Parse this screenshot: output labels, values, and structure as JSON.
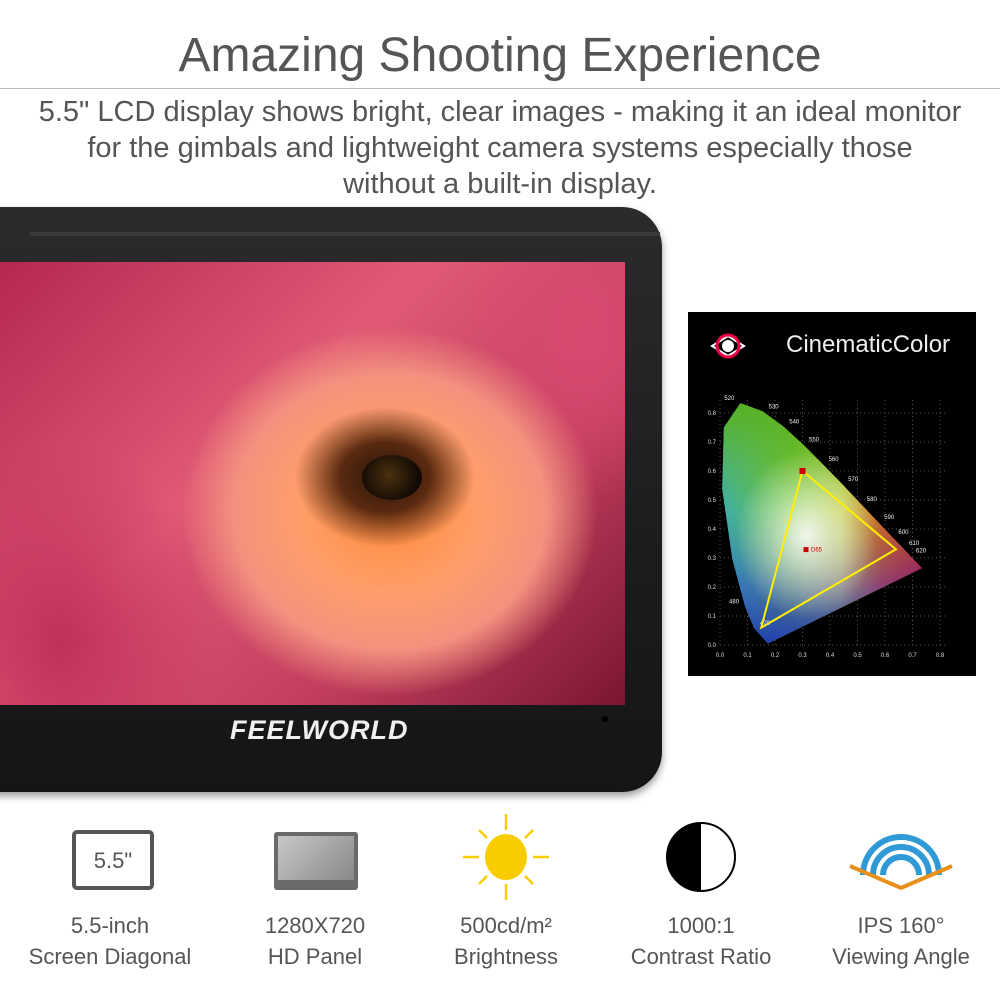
{
  "header": {
    "title": "Amazing Shooting Experience",
    "subtitle_lines": [
      "5.5\" LCD display shows bright, clear images - making it an ideal monitor",
      "for the gimbals and lightweight camera systems especially those",
      "without a built-in display."
    ]
  },
  "monitor": {
    "brand_logo": "FEELWORLD"
  },
  "cinematic_color": {
    "brand": "CinematicColor",
    "white_point_label": "D65",
    "x_ticks": [
      "0.0",
      "0.1",
      "0.2",
      "0.3",
      "0.4",
      "0.5",
      "0.6",
      "0.7",
      "0.8"
    ],
    "y_ticks": [
      "0.0",
      "0.1",
      "0.2",
      "0.3",
      "0.4",
      "0.5",
      "0.6",
      "0.7",
      "0.8"
    ],
    "wavelength_labels": [
      {
        "nm": "470",
        "x": 0.124,
        "y": 0.058
      },
      {
        "nm": "480",
        "x": 0.091,
        "y": 0.133
      },
      {
        "nm": "520",
        "x": 0.074,
        "y": 0.834
      },
      {
        "nm": "530",
        "x": 0.155,
        "y": 0.806
      },
      {
        "nm": "540",
        "x": 0.23,
        "y": 0.754
      },
      {
        "nm": "550",
        "x": 0.302,
        "y": 0.692
      },
      {
        "nm": "560",
        "x": 0.373,
        "y": 0.624
      },
      {
        "nm": "570",
        "x": 0.444,
        "y": 0.555
      },
      {
        "nm": "580",
        "x": 0.512,
        "y": 0.487
      },
      {
        "nm": "590",
        "x": 0.575,
        "y": 0.424
      },
      {
        "nm": "600",
        "x": 0.627,
        "y": 0.372
      },
      {
        "nm": "610",
        "x": 0.666,
        "y": 0.334
      },
      {
        "nm": "620",
        "x": 0.691,
        "y": 0.308
      }
    ],
    "gamut_triangle": [
      [
        0.3,
        0.6
      ],
      [
        0.64,
        0.33
      ],
      [
        0.15,
        0.06
      ]
    ],
    "white_point": [
      0.3127,
      0.329
    ]
  },
  "features": [
    {
      "icon": "screen-diagonal-icon",
      "icon_text": "5.5\"",
      "line1": "5.5-inch",
      "line2": "Screen Diagonal"
    },
    {
      "icon": "hd-panel-icon",
      "line1": "1280X720",
      "line2": "HD Panel"
    },
    {
      "icon": "sun-icon",
      "line1": "500cd/m²",
      "line2": "Brightness",
      "color": "#f9cc00"
    },
    {
      "icon": "contrast-icon",
      "line1": "1000:1",
      "line2": "Contrast Ratio"
    },
    {
      "icon": "viewing-angle-icon",
      "line1": "IPS 160°",
      "line2": "Viewing Angle",
      "color": "#2f9ad6",
      "accent": "#e8901c"
    }
  ]
}
